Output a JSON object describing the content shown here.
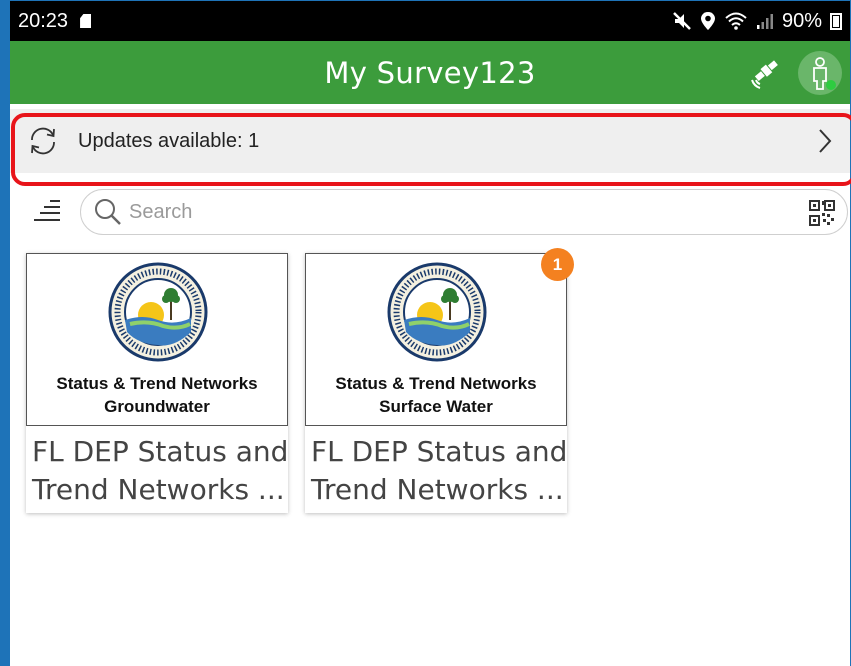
{
  "status_bar": {
    "time": "20:23",
    "battery": "90%"
  },
  "app_bar": {
    "title": "My Survey123"
  },
  "updates": {
    "label": "Updates available: 1"
  },
  "search": {
    "placeholder": "Search"
  },
  "surveys": [
    {
      "thumb_line1": "Status & Trend Networks",
      "thumb_line2": "Groundwater",
      "name_line1": "FL DEP Status and",
      "name_line2": "Trend Networks ...",
      "badge": ""
    },
    {
      "thumb_line1": "Status & Trend Networks",
      "thumb_line2": "Surface Water",
      "name_line1": "FL DEP Status and",
      "name_line2": "Trend Networks ...",
      "badge": "1"
    }
  ],
  "colors": {
    "app_bar": "#3c9c3c",
    "highlight": "#e8141a",
    "badge": "#f48120",
    "frame": "#1e73b8"
  }
}
